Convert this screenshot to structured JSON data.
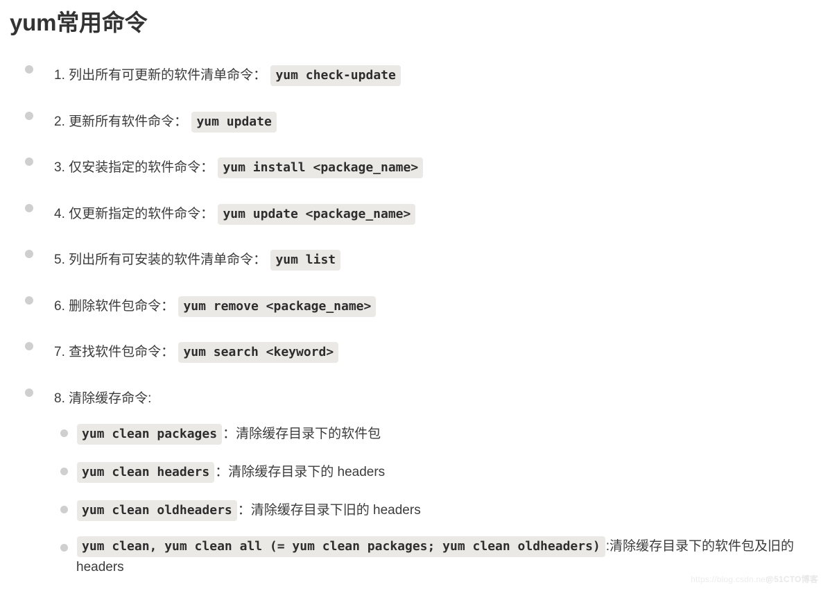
{
  "title": "yum常用命令",
  "colors": {
    "code_bg": "#ebe9e5",
    "text": "#3b3b3b",
    "bullet": "#cfcfcf",
    "title": "#333333",
    "watermark": "#ececec"
  },
  "main_list": [
    {
      "index": "1.",
      "text": "列出所有可更新的软件清单命令：",
      "code": "yum check-update"
    },
    {
      "index": "2.",
      "text": "更新所有软件命令：",
      "code": "yum update"
    },
    {
      "index": "3.",
      "text": "仅安装指定的软件命令：",
      "code": "yum install <package_name>"
    },
    {
      "index": "4.",
      "text": "仅更新指定的软件命令：",
      "code": "yum update <package_name>"
    },
    {
      "index": "5.",
      "text": "列出所有可安装的软件清单命令：",
      "code": "yum list"
    },
    {
      "index": "6.",
      "text": "删除软件包命令：",
      "code": "yum remove <package_name>"
    },
    {
      "index": "7.",
      "text": "查找软件包命令：",
      "code": "yum search <keyword>"
    },
    {
      "index": "8.",
      "text": "清除缓存命令:",
      "code": ""
    }
  ],
  "sub_list": [
    {
      "code": "yum clean packages",
      "desc": "：清除缓存目录下的软件包"
    },
    {
      "code": "yum clean headers",
      "desc": "：清除缓存目录下的 headers"
    },
    {
      "code": "yum clean oldheaders",
      "desc": "：清除缓存目录下旧的 headers"
    },
    {
      "code": "yum clean, yum clean all (= yum clean packages; yum clean oldheaders)",
      "desc": ":清除缓存目录下的软件包及旧的 headers"
    }
  ],
  "watermark": {
    "url": "https://blog.csdn.net/",
    "brand": "@51CTO博客"
  }
}
